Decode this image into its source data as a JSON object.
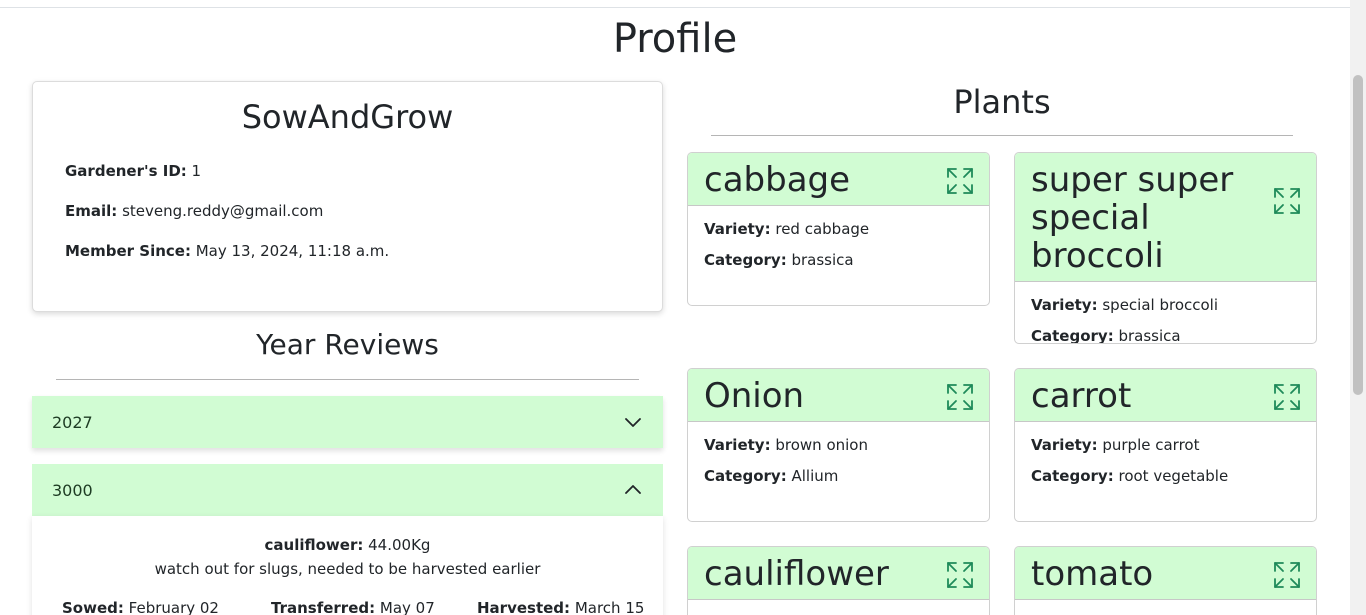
{
  "page": {
    "title": "Profile"
  },
  "profile": {
    "username": "SowAndGrow",
    "id_label": "Gardener's ID:",
    "id_value": "1",
    "email_label": "Email:",
    "email_value": "steveng.reddy@gmail.com",
    "since_label": "Member Since:",
    "since_value": "May 13, 2024, 11:18 a.m."
  },
  "reviews": {
    "title": "Year Reviews",
    "items": [
      {
        "year": "2027",
        "expanded": false
      },
      {
        "year": "3000",
        "expanded": true
      }
    ],
    "detail": {
      "crop_label": "cauliflower:",
      "crop_value": "44.00Kg",
      "note": "watch out for slugs, needed to be harvested earlier",
      "sowed_label": "Sowed:",
      "sowed_value": "February 02",
      "transferred_label": "Transferred:",
      "transferred_value": "May 07",
      "harvested_label": "Harvested:",
      "harvested_value": "March 15"
    }
  },
  "plants": {
    "title": "Plants",
    "variety_label": "Variety:",
    "category_label": "Category:",
    "items": [
      {
        "name": "cabbage",
        "variety": "red cabbage",
        "category": "brassica"
      },
      {
        "name": "super super special broccoli",
        "variety": "special broccoli",
        "category": "brassica"
      },
      {
        "name": "Onion",
        "variety": "brown onion",
        "category": "Allium"
      },
      {
        "name": "carrot",
        "variety": "purple carrot",
        "category": "root vegetable"
      },
      {
        "name": "cauliflower",
        "variety": "",
        "category": ""
      },
      {
        "name": "tomato",
        "variety": "",
        "category": ""
      }
    ]
  },
  "colors": {
    "accent_green": "#d1fcd3",
    "icon_green": "#1f8a5a"
  },
  "icons": {
    "expand": "expand-arrows-icon",
    "chevron_down": "chevron-down-icon",
    "chevron_up": "chevron-up-icon"
  }
}
